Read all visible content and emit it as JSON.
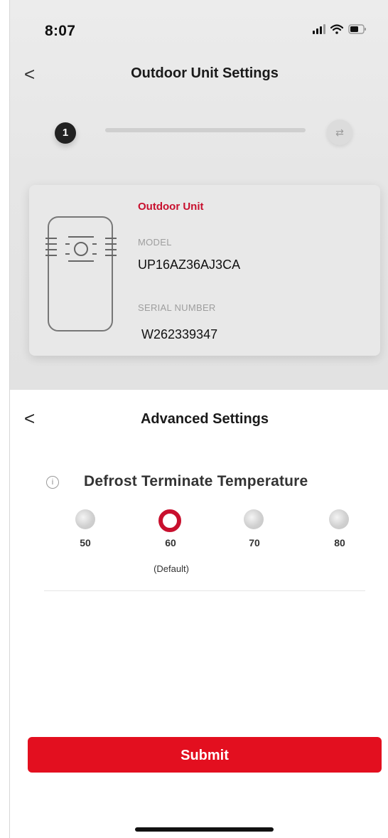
{
  "status_bar": {
    "time": "8:07"
  },
  "top_header": {
    "title": "Outdoor Unit Settings",
    "back_glyph": "<"
  },
  "stepper": {
    "current_step": "1",
    "next_step_icon": "swap-icon"
  },
  "unit_card": {
    "heading": "Outdoor Unit",
    "model_label": "MODEL",
    "model_value": "UP16AZ36AJ3CA",
    "serial_label": "SERIAL NUMBER",
    "serial_value": "W262339347",
    "icon": "outdoor-unit-icon"
  },
  "sheet": {
    "title": "Advanced Settings",
    "back_glyph": "<",
    "setting": {
      "label": "Defrost Terminate Temperature",
      "info_icon": "info-icon",
      "options": [
        {
          "value": "50",
          "selected": false
        },
        {
          "value": "60",
          "selected": true
        },
        {
          "value": "70",
          "selected": false
        },
        {
          "value": "80",
          "selected": false
        }
      ],
      "default_note": "(Default)"
    },
    "submit_label": "Submit"
  },
  "colors": {
    "accent": "#c8102e",
    "button": "#e30f1f"
  }
}
